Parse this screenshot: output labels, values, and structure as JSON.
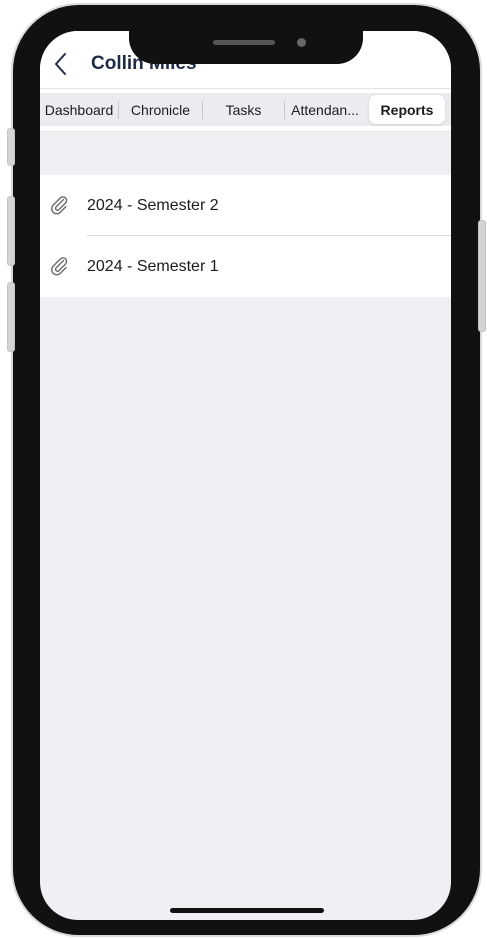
{
  "header": {
    "title": "Collin Miles",
    "back_icon": "chevron-left-icon"
  },
  "tabs": [
    {
      "label": "Dashboard",
      "active": false
    },
    {
      "label": "Chronicle",
      "active": false
    },
    {
      "label": "Tasks",
      "active": false
    },
    {
      "label": "Attendan...",
      "active": false
    },
    {
      "label": "Reports",
      "active": true
    }
  ],
  "reports": [
    {
      "label": "2024 - Semester 2",
      "icon": "paperclip-icon"
    },
    {
      "label": "2024 - Semester 1",
      "icon": "paperclip-icon"
    }
  ],
  "colors": {
    "title": "#1f2a44",
    "background": "#efeff4",
    "surface": "#ffffff"
  }
}
